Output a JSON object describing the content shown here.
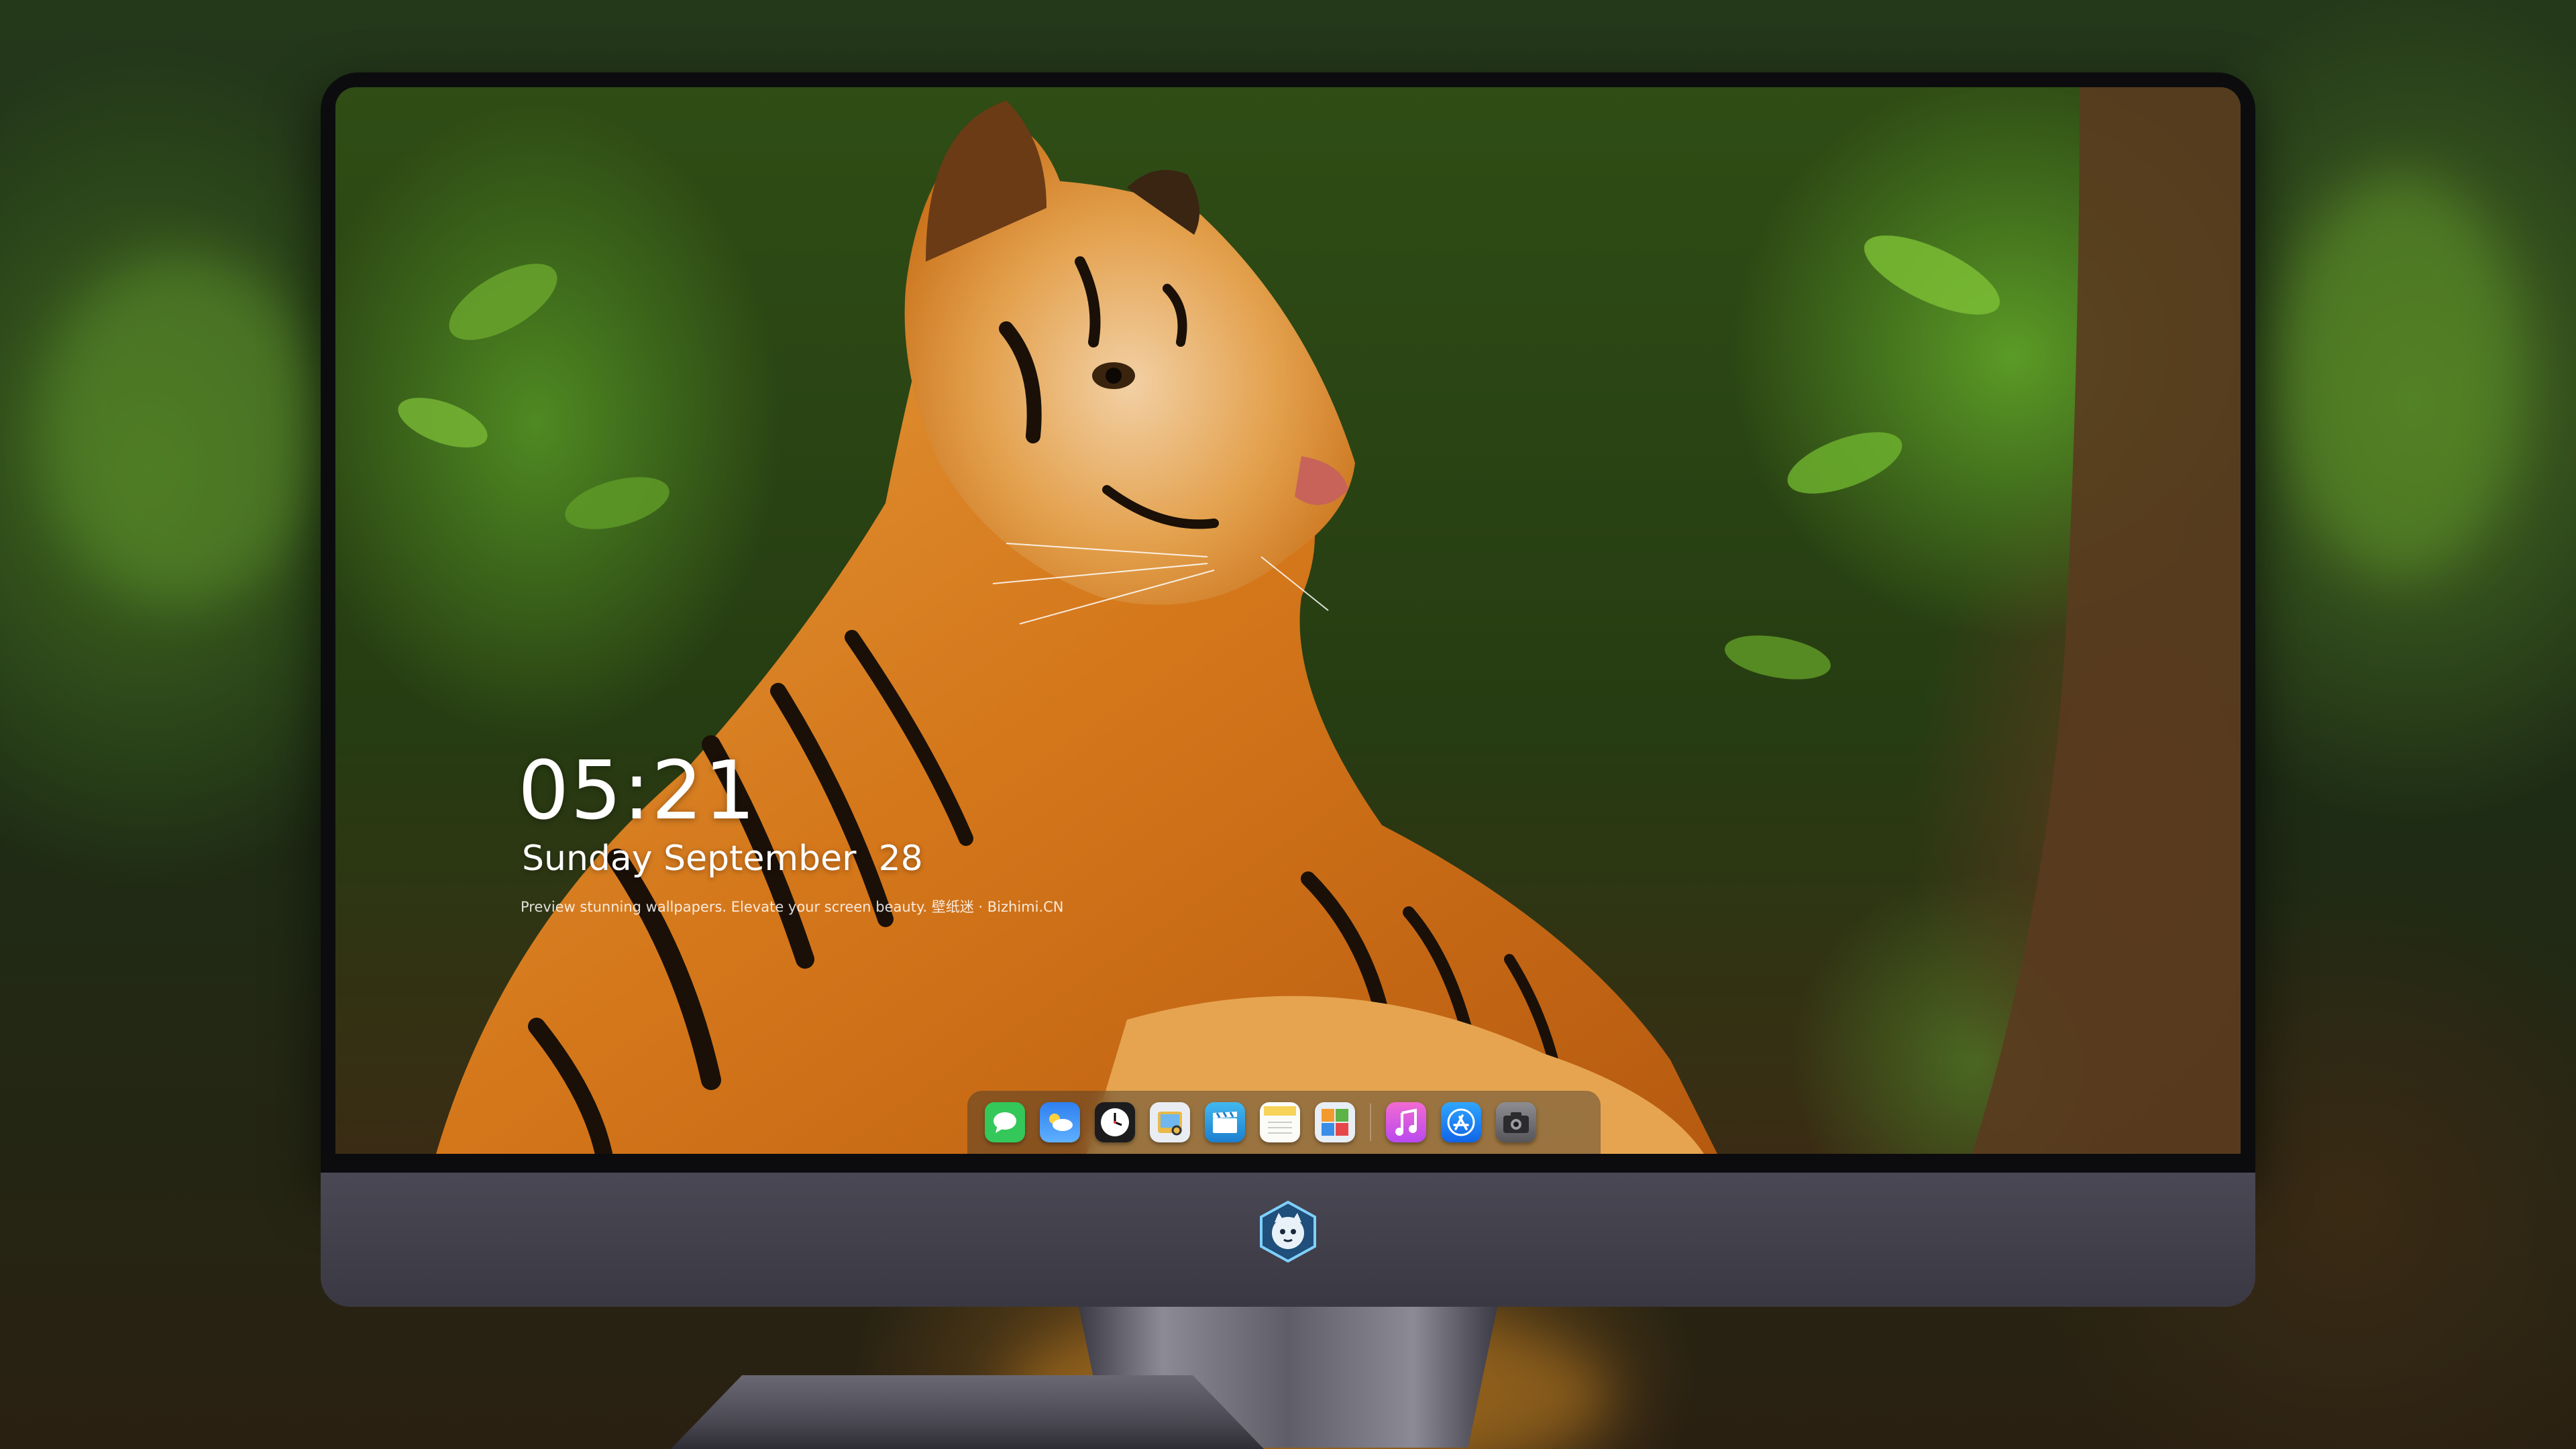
{
  "lock_screen": {
    "time": "05:21",
    "date": "Sunday September  28",
    "tagline": "Preview stunning wallpapers. Elevate your screen beauty. 壁纸迷 · Bizhimi.CN"
  },
  "dock": {
    "apps": [
      {
        "name": "messages",
        "icon": "speech-bubble-icon",
        "color": "#34c759"
      },
      {
        "name": "weather",
        "icon": "cloud-icon",
        "color": "#3b8ef5"
      },
      {
        "name": "clock",
        "icon": "clock-icon",
        "color": "#ffffff"
      },
      {
        "name": "preview",
        "icon": "preview-icon",
        "color": "#e9b949"
      },
      {
        "name": "clips",
        "icon": "clapperboard-icon",
        "color": "#30a0e6"
      },
      {
        "name": "notes",
        "icon": "notes-icon",
        "color": "#f7d35a"
      },
      {
        "name": "photo-booth",
        "icon": "photo-collage-icon",
        "color": "#e7eef5"
      },
      {
        "name": "music",
        "icon": "music-note-icon",
        "color": "#f061c6"
      },
      {
        "name": "app-store",
        "icon": "app-store-icon",
        "color": "#1a8cff"
      },
      {
        "name": "camera",
        "icon": "camera-icon",
        "color": "#6e6e72"
      }
    ]
  },
  "colors": {
    "tiger_orange": "#d9791d",
    "foliage_green": "#4f8a22",
    "monitor_chin": "#45434d"
  }
}
